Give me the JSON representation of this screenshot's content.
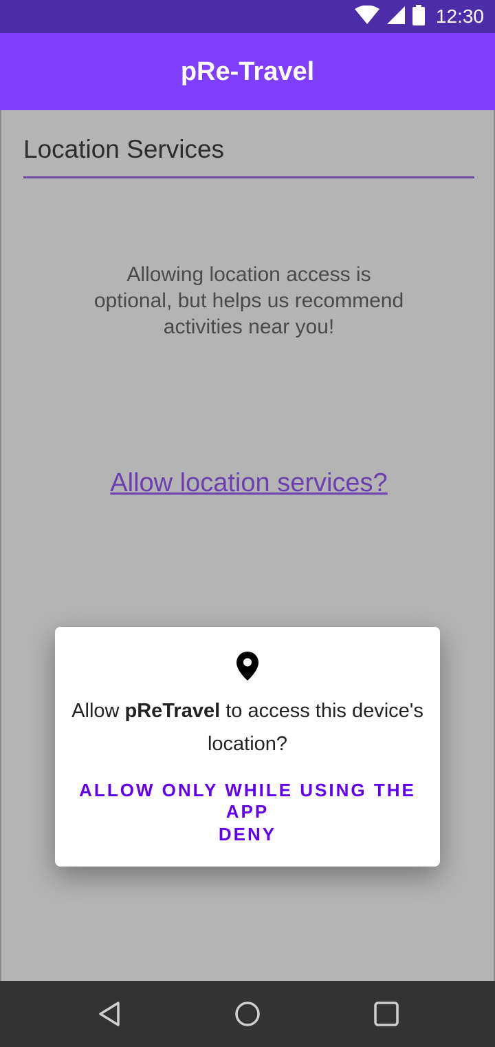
{
  "status_bar": {
    "time": "12:30",
    "icons": [
      "wifi-icon",
      "signal-icon",
      "battery-icon"
    ]
  },
  "app_bar": {
    "title": "pRe-Travel"
  },
  "main": {
    "section_title": "Location Services",
    "info_text": "Allowing location access is optional, but helps us recommend activities near you!",
    "allow_link": "Allow location services?"
  },
  "dialog": {
    "icon": "location-pin-icon",
    "message_prefix": "Allow ",
    "app_name": "pReTravel",
    "message_suffix": " to access this device's location?",
    "allow_button": "ALLOW ONLY WHILE USING THE APP",
    "deny_button": "DENY"
  },
  "nav_bar": {
    "buttons": [
      "back-icon",
      "home-icon",
      "recents-icon"
    ]
  },
  "colors": {
    "status_bar": "#4d2ca8",
    "app_bar": "#7f3dfc",
    "accent": "#6200ee",
    "link": "#6a3fb0",
    "scrim": "#b4b4b4"
  }
}
